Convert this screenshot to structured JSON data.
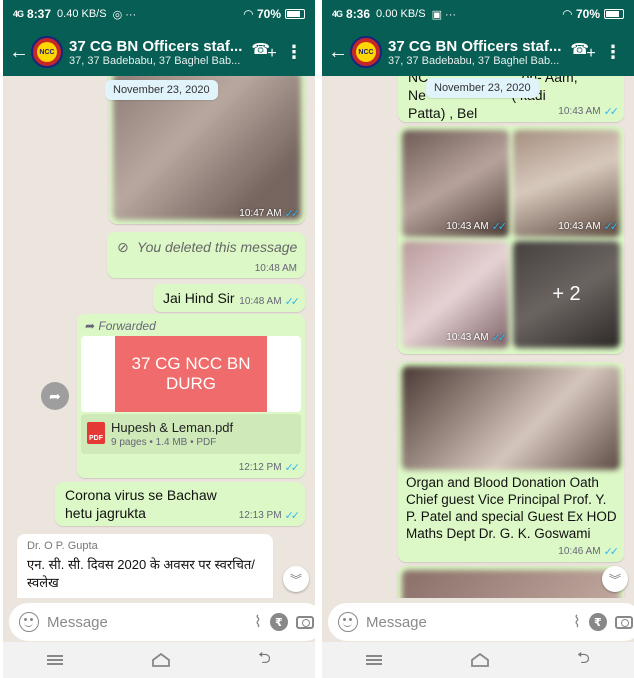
{
  "left": {
    "status": {
      "time": "8:37",
      "signal": "4G",
      "speed": "0.40 KB/S",
      "percent": "70%"
    },
    "header": {
      "title": "37 CG BN Officers staf...",
      "subtitle": "37, 37 Badebabu, 37 Baghel Bab..."
    },
    "date_chip": "November 23, 2020",
    "messages": {
      "image_time": "10:47 AM",
      "deleted_text": "You deleted this message",
      "deleted_time": "10:48 AM",
      "jai_text": "Jai Hind Sir",
      "jai_time": "10:48 AM",
      "forwarded_label": "Forwarded",
      "pdf_preview_text": "37 CG NCC BN DURG",
      "pdf_name": "Hupesh & Leman.pdf",
      "pdf_info": "9 pages • 1.4 MB • PDF",
      "pdf_time": "12:12 PM",
      "corona_text": "Corona virus se Bachaw hetu jagrukta",
      "corona_time": "12:13 PM",
      "incoming_sender": "Dr. O P. Gupta",
      "incoming_text": "एन. सी. सी. दिवस 2020 के अवसर पर स्वरचित/स्वलेख"
    },
    "input_placeholder": "Message"
  },
  "right": {
    "status": {
      "time": "8:36",
      "signal": "4G",
      "speed": "0.00 KB/S",
      "percent": "70%"
    },
    "header": {
      "title": "37 CG BN Officers staf...",
      "subtitle": "37, 37 Badebabu, 37 Baghel Bab..."
    },
    "date_chip": "November 23, 2020",
    "messages": {
      "top_text_line1": "NC                        on- Aam,",
      "top_text_line2": "Ne                      ( kadi",
      "top_text_line3": "Patta) , Bel",
      "top_time": "10:43 AM",
      "grid_time_1": "10:43 AM",
      "grid_time_2": "10:43 AM",
      "grid_time_3": "10:43 AM",
      "grid_more": "+ 2",
      "caption": "Organ and Blood Donation Oath Chief guest Vice Principal Prof. Y. P. Patel and special Guest Ex HOD Maths Dept Dr. G. K. Goswami",
      "caption_time": "10:46 AM"
    },
    "input_placeholder": "Message"
  },
  "colors": {
    "header": "#075e54",
    "outgoing": "#dcf8c6",
    "incoming": "#ffffff",
    "chat_bg": "#ece5dd",
    "accent": "#00a884",
    "tick": "#34b7f1"
  },
  "icons": [
    "back-arrow-icon",
    "add-call-icon",
    "more-options-icon",
    "emoji-icon",
    "attach-icon",
    "rupee-icon",
    "camera-icon",
    "mic-icon",
    "forward-icon",
    "pdf-icon",
    "blocked-icon",
    "read-ticks-icon",
    "chevron-down-icon",
    "nav-menu-icon",
    "nav-home-icon",
    "nav-back-icon"
  ]
}
